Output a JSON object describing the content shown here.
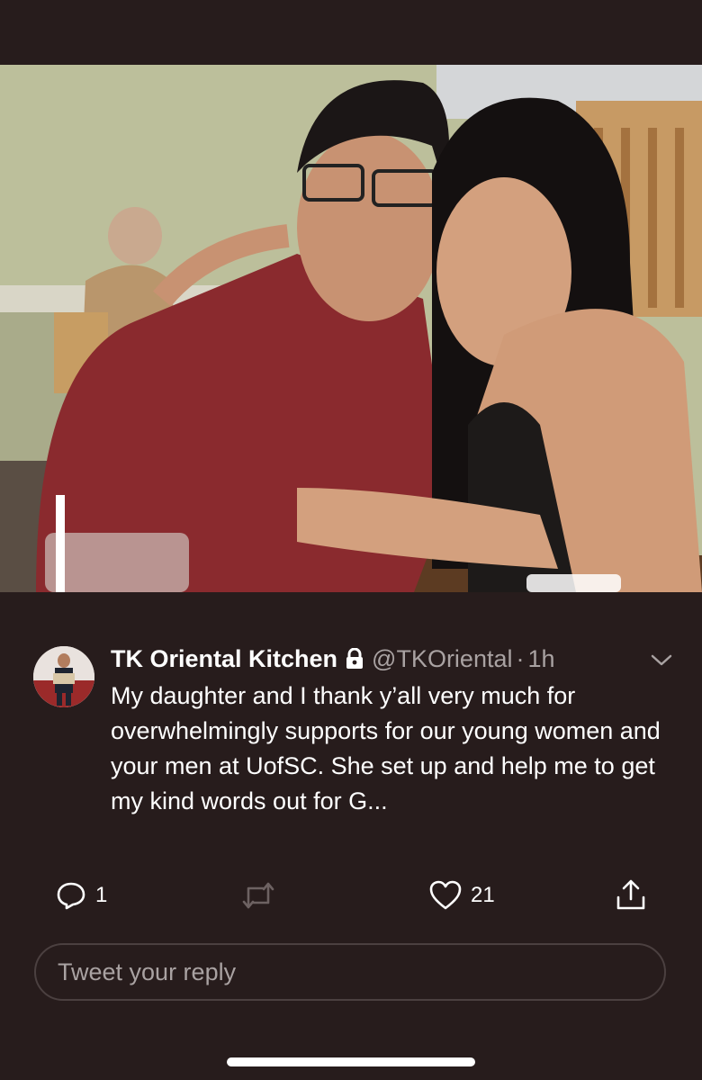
{
  "photo": {
    "description_icon": "photo-of-two-people"
  },
  "tweet": {
    "author_name": "TK Oriental Kitchen",
    "handle": "@TKOriental",
    "separator": "·",
    "time": "1h",
    "text": "My daughter and I thank y’all very much for overwhelmingly supports for our young women and your men at UofSC. She set up and help me to get my kind words out for G..."
  },
  "actions": {
    "reply_count": "1",
    "retweet_count": "",
    "like_count": "21"
  },
  "reply": {
    "placeholder": "Tweet your reply"
  },
  "colors": {
    "background": "#271c1c",
    "muted": "#a9a2a2",
    "border": "#4b4040"
  }
}
